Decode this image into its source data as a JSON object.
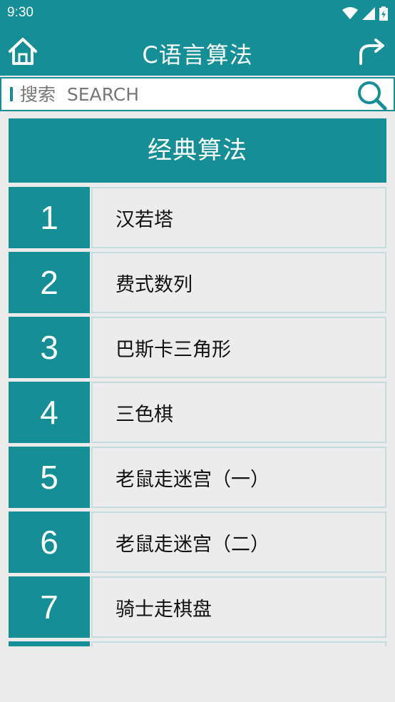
{
  "status_bar": {
    "time": "9:30"
  },
  "app_bar": {
    "title": "C语言算法"
  },
  "search": {
    "placeholder": "搜索  SEARCH"
  },
  "section": {
    "title": "经典算法"
  },
  "items": [
    {
      "num": "1",
      "name": "汉若塔"
    },
    {
      "num": "2",
      "name": "费式数列"
    },
    {
      "num": "3",
      "name": "巴斯卡三角形"
    },
    {
      "num": "4",
      "name": "三色棋"
    },
    {
      "num": "5",
      "name": "老鼠走迷宫（一）"
    },
    {
      "num": "6",
      "name": "老鼠走迷宫（二）"
    },
    {
      "num": "7",
      "name": "骑士走棋盘"
    },
    {
      "num": "",
      "name": ""
    }
  ],
  "colors": {
    "accent": "#158f95",
    "row_bg": "#ececec",
    "page_bg": "#ebebeb"
  },
  "icons": {
    "home": "home-icon",
    "share": "share-icon",
    "search": "search-icon"
  }
}
